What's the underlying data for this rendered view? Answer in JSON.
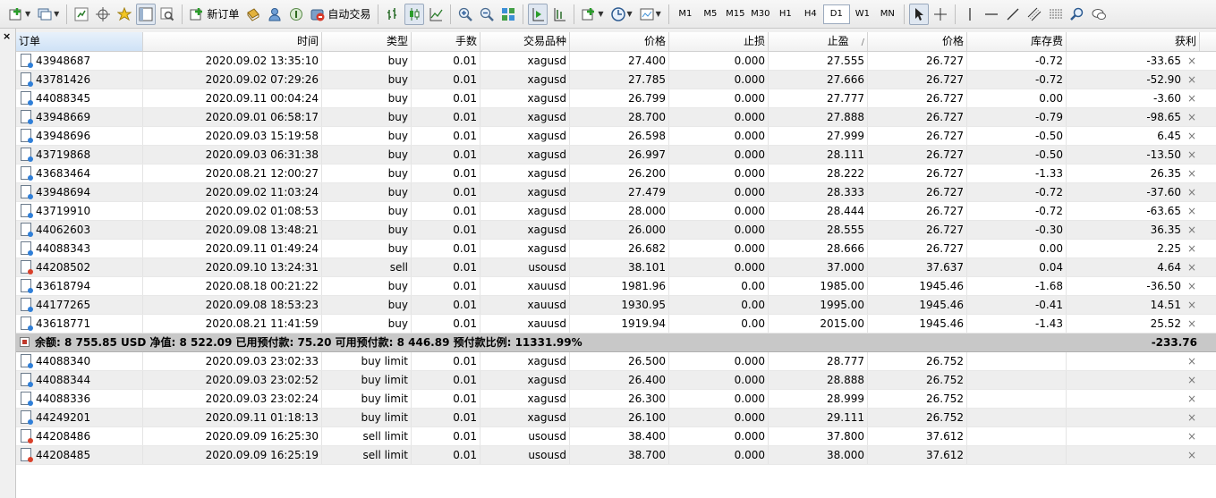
{
  "toolbar": {
    "new_order_label": "新订单",
    "autotrade_label": "自动交易",
    "timeframes": [
      "M1",
      "M5",
      "M15",
      "M30",
      "H1",
      "H4",
      "D1",
      "W1",
      "MN"
    ],
    "active_timeframe": "D1"
  },
  "side": {
    "close": "×"
  },
  "columns": [
    "订单",
    "时间",
    "类型",
    "手数",
    "交易品种",
    "价格",
    "止损",
    "止盈",
    "价格",
    "库存费",
    "获利"
  ],
  "sort_marker": "/",
  "positions": [
    {
      "order": "43948687",
      "time": "2020.09.02 13:35:10",
      "type": "buy",
      "lots": "0.01",
      "symbol": "xagusd",
      "price": "27.400",
      "sl": "0.000",
      "tp": "27.555",
      "cur": "26.727",
      "swap": "-0.72",
      "profit": "-33.65"
    },
    {
      "order": "43781426",
      "time": "2020.09.02 07:29:26",
      "type": "buy",
      "lots": "0.01",
      "symbol": "xagusd",
      "price": "27.785",
      "sl": "0.000",
      "tp": "27.666",
      "cur": "26.727",
      "swap": "-0.72",
      "profit": "-52.90"
    },
    {
      "order": "44088345",
      "time": "2020.09.11 00:04:24",
      "type": "buy",
      "lots": "0.01",
      "symbol": "xagusd",
      "price": "26.799",
      "sl": "0.000",
      "tp": "27.777",
      "cur": "26.727",
      "swap": "0.00",
      "profit": "-3.60"
    },
    {
      "order": "43948669",
      "time": "2020.09.01 06:58:17",
      "type": "buy",
      "lots": "0.01",
      "symbol": "xagusd",
      "price": "28.700",
      "sl": "0.000",
      "tp": "27.888",
      "cur": "26.727",
      "swap": "-0.79",
      "profit": "-98.65"
    },
    {
      "order": "43948696",
      "time": "2020.09.03 15:19:58",
      "type": "buy",
      "lots": "0.01",
      "symbol": "xagusd",
      "price": "26.598",
      "sl": "0.000",
      "tp": "27.999",
      "cur": "26.727",
      "swap": "-0.50",
      "profit": "6.45"
    },
    {
      "order": "43719868",
      "time": "2020.09.03 06:31:38",
      "type": "buy",
      "lots": "0.01",
      "symbol": "xagusd",
      "price": "26.997",
      "sl": "0.000",
      "tp": "28.111",
      "cur": "26.727",
      "swap": "-0.50",
      "profit": "-13.50"
    },
    {
      "order": "43683464",
      "time": "2020.08.21 12:00:27",
      "type": "buy",
      "lots": "0.01",
      "symbol": "xagusd",
      "price": "26.200",
      "sl": "0.000",
      "tp": "28.222",
      "cur": "26.727",
      "swap": "-1.33",
      "profit": "26.35"
    },
    {
      "order": "43948694",
      "time": "2020.09.02 11:03:24",
      "type": "buy",
      "lots": "0.01",
      "symbol": "xagusd",
      "price": "27.479",
      "sl": "0.000",
      "tp": "28.333",
      "cur": "26.727",
      "swap": "-0.72",
      "profit": "-37.60"
    },
    {
      "order": "43719910",
      "time": "2020.09.02 01:08:53",
      "type": "buy",
      "lots": "0.01",
      "symbol": "xagusd",
      "price": "28.000",
      "sl": "0.000",
      "tp": "28.444",
      "cur": "26.727",
      "swap": "-0.72",
      "profit": "-63.65"
    },
    {
      "order": "44062603",
      "time": "2020.09.08 13:48:21",
      "type": "buy",
      "lots": "0.01",
      "symbol": "xagusd",
      "price": "26.000",
      "sl": "0.000",
      "tp": "28.555",
      "cur": "26.727",
      "swap": "-0.30",
      "profit": "36.35"
    },
    {
      "order": "44088343",
      "time": "2020.09.11 01:49:24",
      "type": "buy",
      "lots": "0.01",
      "symbol": "xagusd",
      "price": "26.682",
      "sl": "0.000",
      "tp": "28.666",
      "cur": "26.727",
      "swap": "0.00",
      "profit": "2.25"
    },
    {
      "order": "44208502",
      "time": "2020.09.10 13:24:31",
      "type": "sell",
      "lots": "0.01",
      "symbol": "usousd",
      "price": "38.101",
      "sl": "0.000",
      "tp": "37.000",
      "cur": "37.637",
      "swap": "0.04",
      "profit": "4.64"
    },
    {
      "order": "43618794",
      "time": "2020.08.18 00:21:22",
      "type": "buy",
      "lots": "0.01",
      "symbol": "xauusd",
      "price": "1981.96",
      "sl": "0.00",
      "tp": "1985.00",
      "cur": "1945.46",
      "swap": "-1.68",
      "profit": "-36.50"
    },
    {
      "order": "44177265",
      "time": "2020.09.08 18:53:23",
      "type": "buy",
      "lots": "0.01",
      "symbol": "xauusd",
      "price": "1930.95",
      "sl": "0.00",
      "tp": "1995.00",
      "cur": "1945.46",
      "swap": "-0.41",
      "profit": "14.51"
    },
    {
      "order": "43618771",
      "time": "2020.08.21 11:41:59",
      "type": "buy",
      "lots": "0.01",
      "symbol": "xauusd",
      "price": "1919.94",
      "sl": "0.00",
      "tp": "2015.00",
      "cur": "1945.46",
      "swap": "-1.43",
      "profit": "25.52"
    }
  ],
  "summary": {
    "text": "余额: 8 755.85 USD  净值: 8 522.09  已用预付款: 75.20  可用预付款: 8 446.89  预付款比例: 11331.99%",
    "total": "-233.76"
  },
  "pending": [
    {
      "order": "44088340",
      "time": "2020.09.03 23:02:33",
      "type": "buy limit",
      "lots": "0.01",
      "symbol": "xagusd",
      "price": "26.500",
      "sl": "0.000",
      "tp": "28.777",
      "cur": "26.752",
      "swap": "",
      "profit": ""
    },
    {
      "order": "44088344",
      "time": "2020.09.03 23:02:52",
      "type": "buy limit",
      "lots": "0.01",
      "symbol": "xagusd",
      "price": "26.400",
      "sl": "0.000",
      "tp": "28.888",
      "cur": "26.752",
      "swap": "",
      "profit": ""
    },
    {
      "order": "44088336",
      "time": "2020.09.03 23:02:24",
      "type": "buy limit",
      "lots": "0.01",
      "symbol": "xagusd",
      "price": "26.300",
      "sl": "0.000",
      "tp": "28.999",
      "cur": "26.752",
      "swap": "",
      "profit": ""
    },
    {
      "order": "44249201",
      "time": "2020.09.11 01:18:13",
      "type": "buy limit",
      "lots": "0.01",
      "symbol": "xagusd",
      "price": "26.100",
      "sl": "0.000",
      "tp": "29.111",
      "cur": "26.752",
      "swap": "",
      "profit": ""
    },
    {
      "order": "44208486",
      "time": "2020.09.09 16:25:30",
      "type": "sell limit",
      "lots": "0.01",
      "symbol": "usousd",
      "price": "38.400",
      "sl": "0.000",
      "tp": "37.800",
      "cur": "37.612",
      "swap": "",
      "profit": ""
    },
    {
      "order": "44208485",
      "time": "2020.09.09 16:25:19",
      "type": "sell limit",
      "lots": "0.01",
      "symbol": "usousd",
      "price": "38.700",
      "sl": "0.000",
      "tp": "38.000",
      "cur": "37.612",
      "swap": "",
      "profit": ""
    }
  ],
  "delete_glyph": "×",
  "colors": {
    "header_sorted": "#cfe2f6",
    "row_alt": "#eeeeee",
    "summary_bg": "#c8c8c8",
    "buy": "#2f7fd8",
    "sell": "#d9412b"
  }
}
